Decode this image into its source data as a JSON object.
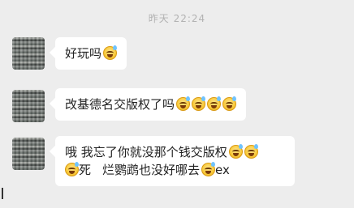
{
  "header": {
    "timestamp": "昨天 22:24"
  },
  "messages": [
    {
      "text": "好玩吗",
      "emoji_count": 1
    },
    {
      "text": "改基德名交版权了吗",
      "emoji_count": 4
    },
    {
      "line1_text": "哦 我忘了你就没那个钱交版权",
      "line1_emoji_count": 2,
      "line2_a": "死",
      "line2_b": "烂鹦鹉也没好哪去",
      "line2_c": "ex"
    }
  ],
  "icons": {
    "emoji": "grinning-sweat-emoji-icon"
  }
}
